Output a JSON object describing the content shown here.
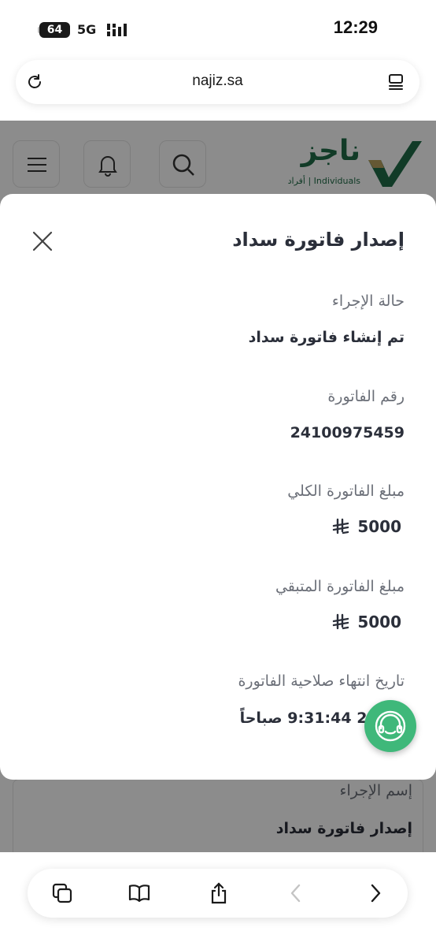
{
  "status_bar": {
    "battery": "64",
    "network": "5G",
    "time": "12:29"
  },
  "browser": {
    "url": "najiz.sa"
  },
  "site": {
    "logo_text": "ناجز",
    "logo_subtitle": "أفراد | Individuals",
    "below_label": "إسم الإجراء",
    "below_value": "إصدار فاتورة سداد"
  },
  "modal": {
    "title": "إصدار فاتورة سداد",
    "fields": [
      {
        "label": "حالة الإجراء",
        "value": "تم إنشاء فاتورة سداد"
      },
      {
        "label": "رقم الفاتورة",
        "value": "24100975459"
      },
      {
        "label": "مبلغ الفاتورة الكلي",
        "value": "5000"
      },
      {
        "label": "مبلغ الفاتورة المتبقي",
        "value": "5000"
      },
      {
        "label": "تاريخ انتهاء صلاحية الفاتورة",
        "value": "-2034 9:31:44 صباحاً"
      }
    ]
  },
  "colors": {
    "brand_green": "#1f6c47",
    "accent_gold": "#b8a160",
    "help_green": "#3fb87a"
  },
  "icons": [
    "reload-icon",
    "tabs-icon",
    "menu-icon",
    "bell-icon",
    "search-icon",
    "close-icon",
    "riyal-icon",
    "support-agent-icon",
    "copy-icon",
    "book-icon",
    "share-icon",
    "back-icon",
    "forward-icon"
  ]
}
